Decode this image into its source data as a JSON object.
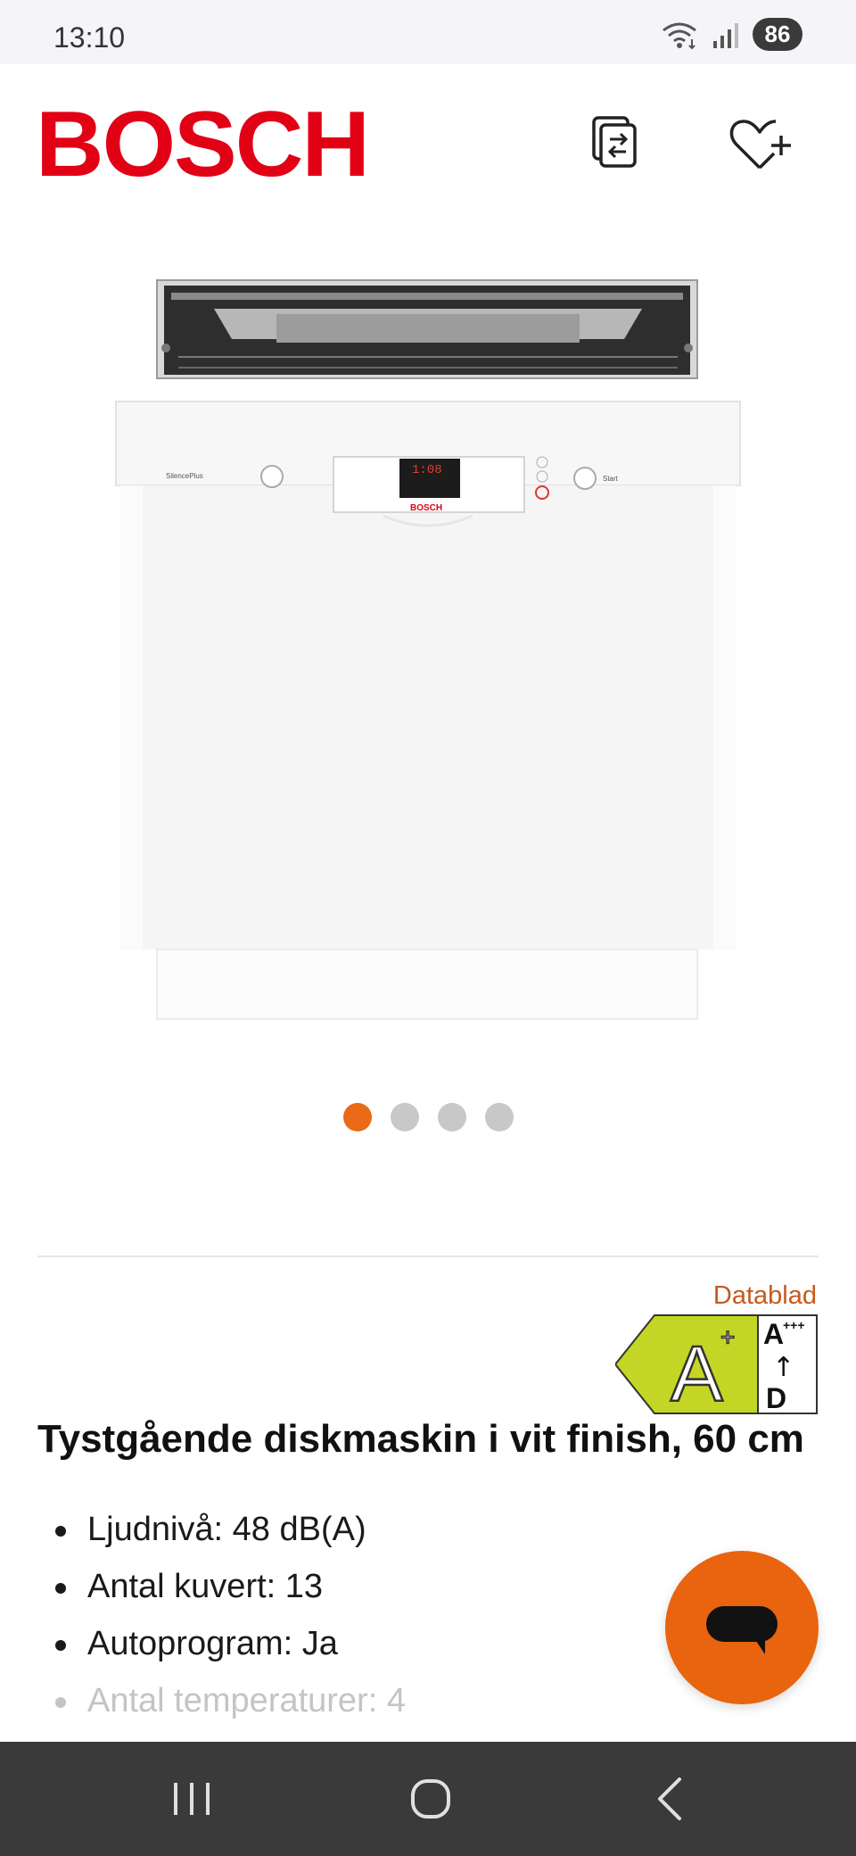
{
  "status_bar": {
    "time": "13:10",
    "battery": "86",
    "icons": [
      "wifi-icon",
      "signal-icon",
      "battery-icon"
    ]
  },
  "header": {
    "logo": "BOSCH",
    "icons": [
      "compare-icon",
      "heart-plus-icon"
    ]
  },
  "carousel": {
    "total": 4,
    "active_index": 0,
    "brand_colors": {
      "active": "#ea6a17",
      "inactive": "#c8c8c8"
    }
  },
  "product_image": {
    "model_label": "SilencePlus",
    "brand": "BOSCH",
    "display": "1:08",
    "start_label": "Start"
  },
  "energy": {
    "datablad": "Datablad",
    "class": "A",
    "class_suffix": "+",
    "scale_top": "A",
    "scale_top_suffix": "+++",
    "scale_arrow": "↑",
    "scale_bottom": "D"
  },
  "product": {
    "title": "Tystgående diskmaskin i vit finish, 60 cm",
    "features": [
      "Ljudnivå: 48 dB(A)",
      "Antal kuvert: 13",
      "Autoprogram: Ja",
      "Antal temperaturer: 4"
    ]
  },
  "colors": {
    "brand_red": "#e20015",
    "accent_orange": "#e8640f",
    "link_orange": "#c65a1d",
    "energy_green": "#c4d625"
  },
  "nav": {
    "icons": [
      "recents-icon",
      "home-icon",
      "back-icon"
    ]
  }
}
